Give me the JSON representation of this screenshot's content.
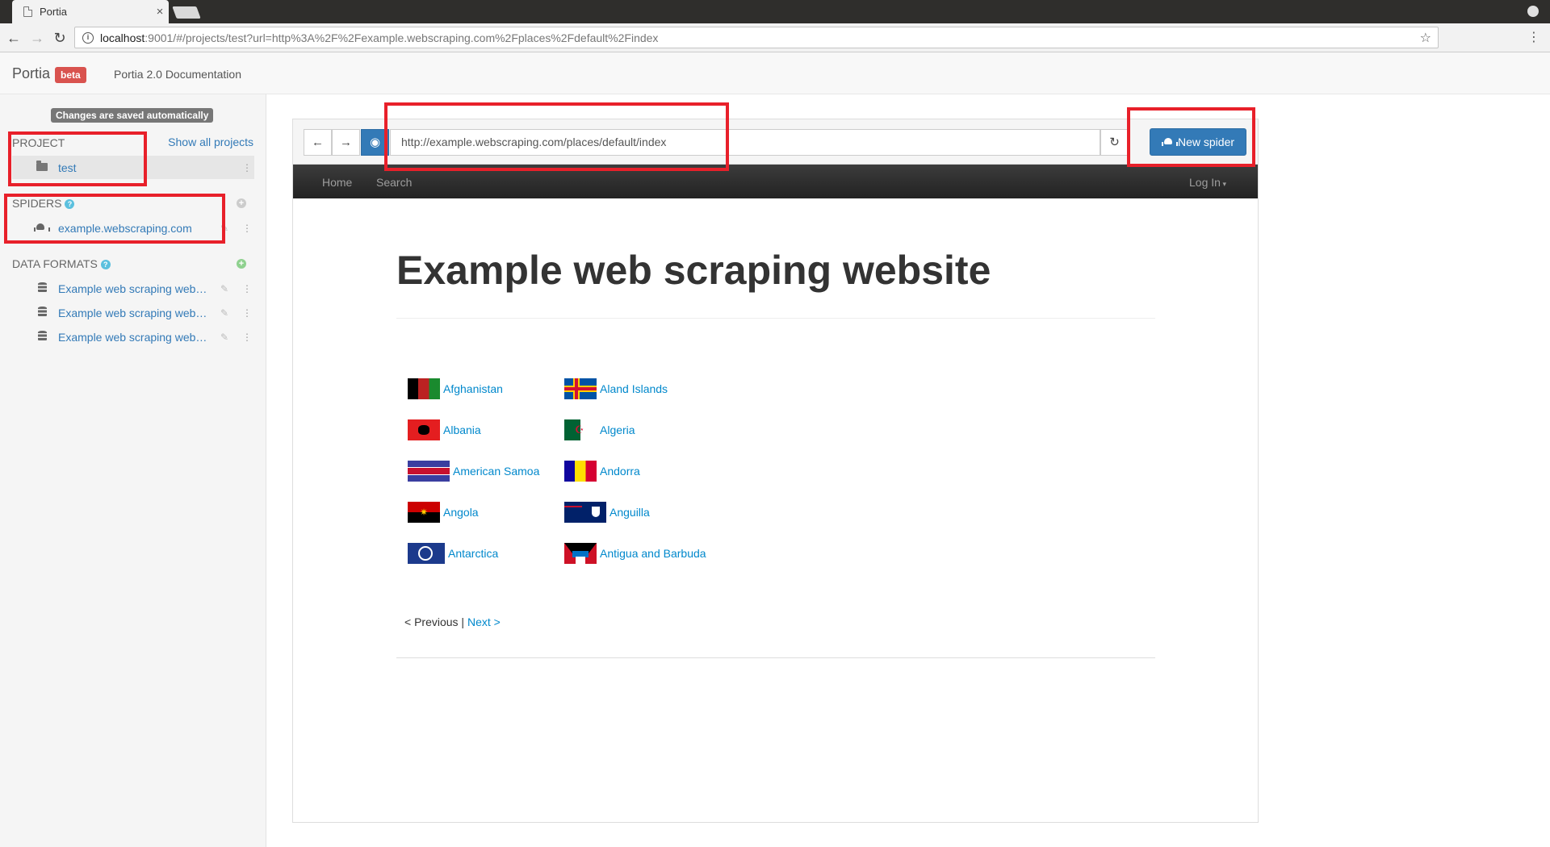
{
  "browser": {
    "tab_title": "Portia",
    "url_host": "localhost",
    "url_rest": ":9001/#/projects/test?url=http%3A%2F%2Fexample.webscraping.com%2Fplaces%2Fdefault%2Findex"
  },
  "header": {
    "brand": "Portia",
    "badge": "beta",
    "docs_link": "Portia 2.0 Documentation"
  },
  "sidebar": {
    "saved_notice": "Changes are saved automatically",
    "project_title": "PROJECT",
    "show_all": "Show all projects",
    "project_name": "test",
    "spiders_title": "SPIDERS",
    "spider_name": "example.webscraping.com",
    "formats_title": "DATA FORMATS",
    "formats": [
      {
        "label": "Example web scraping web…"
      },
      {
        "label": "Example web scraping web…"
      },
      {
        "label": "Example web scraping web…"
      }
    ]
  },
  "main": {
    "page_url": "http://example.webscraping.com/places/default/index",
    "new_spider_label": "New spider"
  },
  "site": {
    "nav": {
      "home": "Home",
      "search": "Search",
      "login": "Log In"
    },
    "heading": "Example web scraping website",
    "countries": [
      {
        "name": "Afghanistan"
      },
      {
        "name": "Aland Islands"
      },
      {
        "name": "Albania"
      },
      {
        "name": "Algeria"
      },
      {
        "name": "American Samoa"
      },
      {
        "name": "Andorra"
      },
      {
        "name": "Angola"
      },
      {
        "name": "Anguilla"
      },
      {
        "name": "Antarctica"
      },
      {
        "name": "Antigua and Barbuda"
      }
    ],
    "pager": {
      "previous": "< Previous",
      "separator": " | ",
      "next": "Next >"
    }
  },
  "colors": {
    "link": "#337ab7",
    "site_link": "#0088cc",
    "beta_badge": "#d9534f",
    "annotation": "#e8202a"
  }
}
